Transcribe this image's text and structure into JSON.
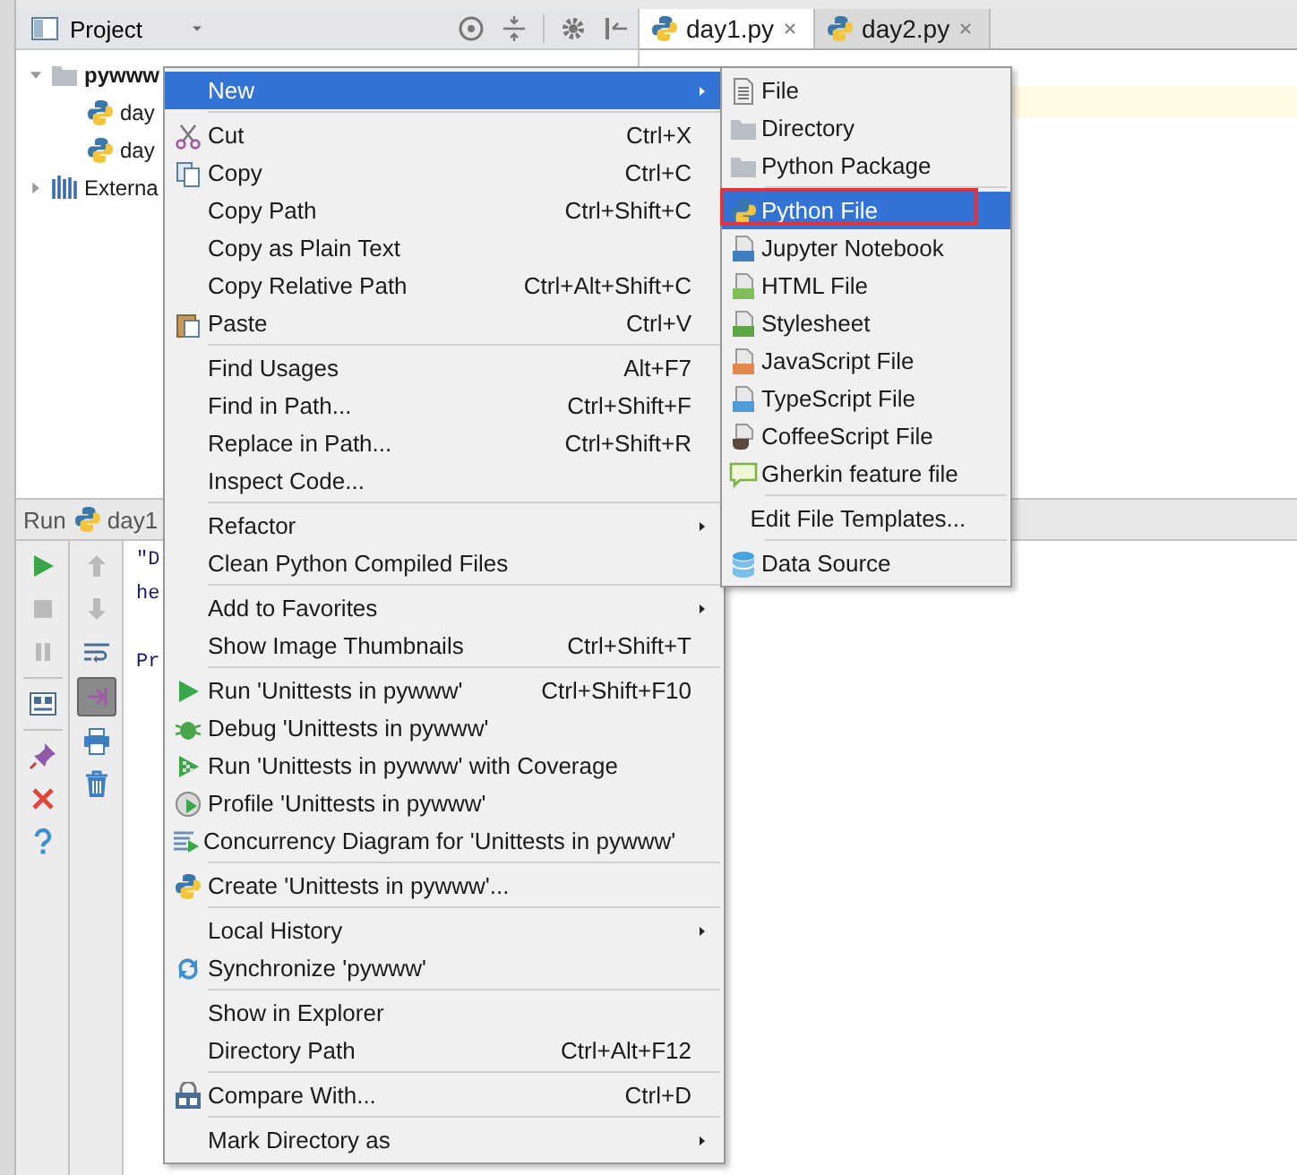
{
  "project_panel": {
    "title": "Project",
    "tree": [
      {
        "label": "pywww",
        "kind": "folder",
        "expanded": true,
        "children": [
          {
            "label": "day",
            "kind": "python"
          },
          {
            "label": "day",
            "kind": "python"
          }
        ]
      },
      {
        "label": "Externa",
        "kind": "library",
        "expanded": false
      }
    ]
  },
  "editor": {
    "tabs": [
      {
        "label": "day1.py",
        "selected": true
      },
      {
        "label": "day2.py",
        "selected": false
      }
    ]
  },
  "run_panel": {
    "title": "Run",
    "config": "day1",
    "toolbar_left": [
      {
        "kind": "run",
        "disabled": false
      },
      {
        "kind": "stop",
        "disabled": true
      },
      {
        "kind": "pause",
        "disabled": true
      },
      {
        "kind": "layout",
        "disabled": false
      },
      {
        "kind": "pin",
        "disabled": false
      },
      {
        "kind": "close",
        "disabled": false
      },
      {
        "kind": "help",
        "disabled": false
      }
    ],
    "toolbar_right": [
      {
        "kind": "up",
        "disabled": true,
        "on": false
      },
      {
        "kind": "down",
        "disabled": true,
        "on": false
      },
      {
        "kind": "wrap",
        "disabled": false,
        "on": false
      },
      {
        "kind": "scroll",
        "disabled": false,
        "on": true
      },
      {
        "kind": "print",
        "disabled": false,
        "on": false
      },
      {
        "kind": "trash",
        "disabled": false,
        "on": false
      }
    ],
    "console_blocks": [
      [
        "\"D",
        "he"
      ],
      [
        "Pr"
      ]
    ]
  },
  "context_menu": {
    "groups": [
      [
        {
          "label": "New",
          "submenu": true,
          "selected": true
        }
      ],
      [
        {
          "label": "Cut",
          "shortcut": "Ctrl+X",
          "kind": "cut",
          "selected": false
        },
        {
          "label": "Copy",
          "shortcut": "Ctrl+C",
          "kind": "copy",
          "selected": false
        },
        {
          "label": "Copy Path",
          "shortcut": "Ctrl+Shift+C",
          "selected": false
        },
        {
          "label": "Copy as Plain Text",
          "selected": false
        },
        {
          "label": "Copy Relative Path",
          "shortcut": "Ctrl+Alt+Shift+C",
          "selected": false
        },
        {
          "label": "Paste",
          "shortcut": "Ctrl+V",
          "kind": "paste",
          "selected": false
        }
      ],
      [
        {
          "label": "Find Usages",
          "shortcut": "Alt+F7",
          "selected": false
        },
        {
          "label": "Find in Path...",
          "shortcut": "Ctrl+Shift+F",
          "selected": false
        },
        {
          "label": "Replace in Path...",
          "shortcut": "Ctrl+Shift+R",
          "selected": false
        },
        {
          "label": "Inspect Code...",
          "selected": false
        }
      ],
      [
        {
          "label": "Refactor",
          "submenu": true,
          "selected": false
        },
        {
          "label": "Clean Python Compiled Files",
          "selected": false
        }
      ],
      [
        {
          "label": "Add to Favorites",
          "submenu": true,
          "selected": false
        },
        {
          "label": "Show Image Thumbnails",
          "shortcut": "Ctrl+Shift+T",
          "selected": false
        }
      ],
      [
        {
          "label": "Run 'Unittests in pywww'",
          "shortcut": "Ctrl+Shift+F10",
          "kind": "run",
          "selected": false
        },
        {
          "label": "Debug 'Unittests in pywww'",
          "kind": "debug",
          "selected": false
        },
        {
          "label": "Run 'Unittests in pywww' with Coverage",
          "kind": "coverage",
          "selected": false
        },
        {
          "label": "Profile 'Unittests in pywww'",
          "kind": "profile",
          "selected": false
        },
        {
          "label": "Concurrency Diagram for  'Unittests in pywww'",
          "kind": "concurrency",
          "selected": false
        }
      ],
      [
        {
          "label": "Create 'Unittests in pywww'...",
          "kind": "python",
          "selected": false
        }
      ],
      [
        {
          "label": "Local History",
          "submenu": true,
          "selected": false
        },
        {
          "label": "Synchronize 'pywww'",
          "kind": "sync",
          "selected": false
        }
      ],
      [
        {
          "label": "Show in Explorer",
          "selected": false
        },
        {
          "label": "Directory Path",
          "shortcut": "Ctrl+Alt+F12",
          "selected": false
        }
      ],
      [
        {
          "label": "Compare With...",
          "shortcut": "Ctrl+D",
          "kind": "compare",
          "selected": false
        }
      ],
      [
        {
          "label": "Mark Directory as",
          "submenu": true,
          "selected": false
        }
      ]
    ]
  },
  "submenu": {
    "groups": [
      [
        {
          "label": "File",
          "kind": "file",
          "selected": false,
          "marked": false
        },
        {
          "label": "Directory",
          "kind": "folder",
          "selected": false,
          "marked": false
        },
        {
          "label": "Python Package",
          "kind": "folder",
          "selected": false,
          "marked": false
        }
      ],
      [
        {
          "label": "Python File",
          "kind": "python",
          "selected": true,
          "marked": true
        },
        {
          "label": "Jupyter Notebook",
          "kind": "notebook",
          "selected": false,
          "marked": false
        },
        {
          "label": "HTML File",
          "kind": "html",
          "selected": false,
          "marked": false
        },
        {
          "label": "Stylesheet",
          "kind": "css",
          "selected": false,
          "marked": false
        },
        {
          "label": "JavaScript File",
          "kind": "js",
          "selected": false,
          "marked": false
        },
        {
          "label": "TypeScript File",
          "kind": "ts",
          "selected": false,
          "marked": false
        },
        {
          "label": "CoffeeScript File",
          "kind": "coffee",
          "selected": false,
          "marked": false
        },
        {
          "label": "Gherkin feature file",
          "kind": "gherkin",
          "selected": false,
          "marked": false
        }
      ],
      [
        {
          "label": "Edit File Templates...",
          "selected": false,
          "marked": false
        }
      ],
      [
        {
          "label": "Data Source",
          "kind": "database",
          "selected": false,
          "marked": false
        }
      ]
    ]
  }
}
